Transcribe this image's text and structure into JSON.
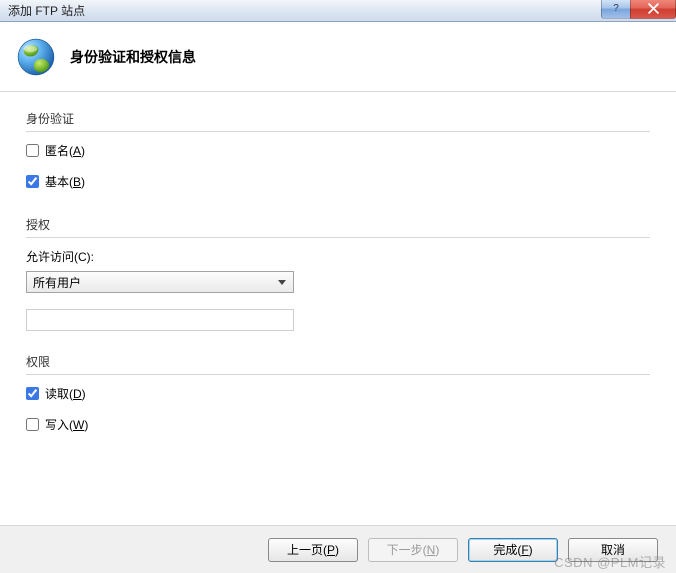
{
  "window": {
    "title": "添加 FTP 站点",
    "help_symbol": "?",
    "close_symbol": "X"
  },
  "header": {
    "page_title": "身份验证和授权信息"
  },
  "auth": {
    "group_label": "身份验证",
    "anonymous": {
      "label_pre": "匿名(",
      "hotkey": "A",
      "label_post": ")",
      "checked": false
    },
    "basic": {
      "label_pre": "基本(",
      "hotkey": "B",
      "label_post": ")",
      "checked": true
    }
  },
  "authorize": {
    "group_label": "授权",
    "allow_label_pre": "允许访问(",
    "allow_hotkey": "C",
    "allow_label_post": "):",
    "selected_option": "所有用户",
    "extra_input_value": ""
  },
  "permissions": {
    "group_label": "权限",
    "read": {
      "label_pre": "读取(",
      "hotkey": "D",
      "label_post": ")",
      "checked": true
    },
    "write": {
      "label_pre": "写入(",
      "hotkey": "W",
      "label_post": ")",
      "checked": false
    }
  },
  "footer": {
    "prev": {
      "pre": "上一页(",
      "hot": "P",
      "post": ")"
    },
    "next": {
      "pre": "下一步(",
      "hot": "N",
      "post": ")"
    },
    "finish": {
      "pre": "完成(",
      "hot": "F",
      "post": ")"
    },
    "cancel": {
      "label": "取消"
    }
  },
  "watermark": "CSDN @PLM记录"
}
